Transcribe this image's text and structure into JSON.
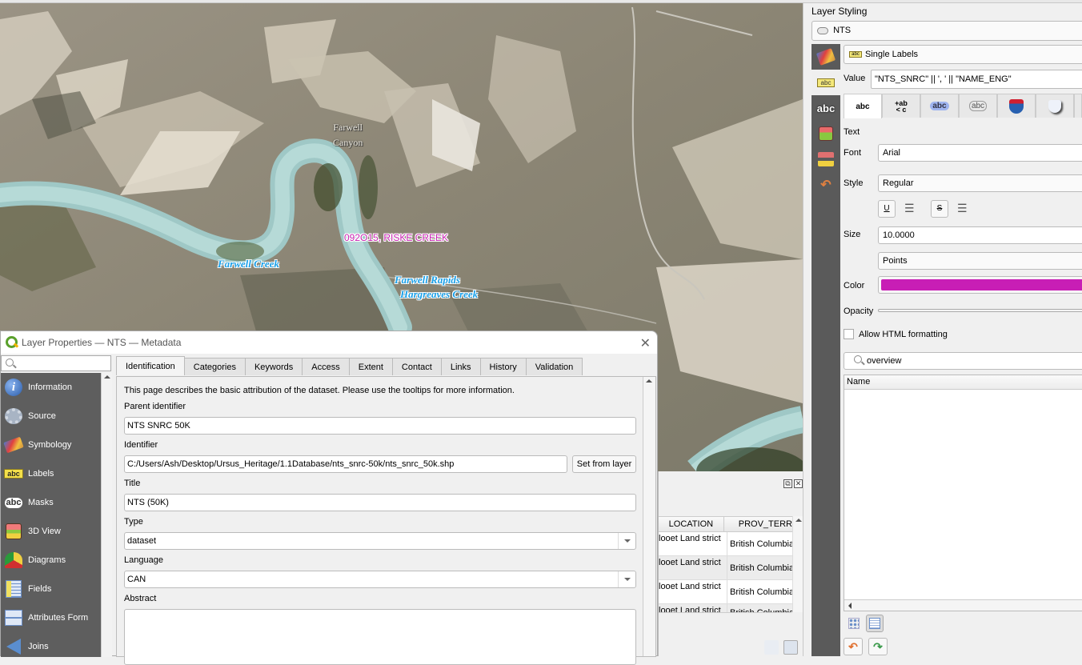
{
  "map": {
    "labels": {
      "nts_label": "092O15, RISKE CREEK",
      "farwell_creek": "Farwell Creek",
      "farwell_rapids": "Farwell Rapids",
      "hargreaves_creek": "Hargreaves Creek",
      "farwell_canyon_line1": "Farwell",
      "farwell_canyon_line2": "Canyon"
    }
  },
  "attribute_table": {
    "columns": [
      "LOCATION",
      "PROV_TERR"
    ],
    "rows": [
      {
        "location": "looet Land strict",
        "prov_terr": "British Columbia"
      },
      {
        "location": "looet Land strict",
        "prov_terr": "British Columbia"
      },
      {
        "location": "looet Land strict",
        "prov_terr": "British Columbia"
      },
      {
        "location": "looet Land strict",
        "prov_terr": "British Columbia"
      }
    ],
    "dock_float": "⧉",
    "dock_close": "✕"
  },
  "styling": {
    "title": "Layer Styling",
    "layer": "NTS",
    "renderer": "Single Labels",
    "value_label": "Value",
    "value": "\"NTS_SNRC\" || ', ' || \"NAME_ENG\"",
    "format_tabs": [
      "abc",
      "+ab<c",
      "abc",
      "abc",
      "shield",
      "shield2"
    ],
    "section_text": "Text",
    "font_label": "Font",
    "font_value": "Arial",
    "style_label": "Style",
    "style_value": "Regular",
    "underline": "U",
    "strike": "S",
    "size_label": "Size",
    "size_value": "10.0000",
    "unit_value": "Points",
    "color_label": "Color",
    "color_value": "#c81eb5",
    "opacity_label": "Opacity",
    "html_label": "Allow HTML formatting",
    "html_checked": false,
    "search_value": "overview",
    "tree_header": "Name"
  },
  "dialog": {
    "title": "Layer Properties — NTS — Metadata",
    "close": "✕",
    "search_placeholder": "",
    "nav": [
      {
        "label": "Information",
        "icon": "info-icon"
      },
      {
        "label": "Source",
        "icon": "source-icon"
      },
      {
        "label": "Symbology",
        "icon": "symbology-icon"
      },
      {
        "label": "Labels",
        "icon": "labels-icon"
      },
      {
        "label": "Masks",
        "icon": "masks-icon"
      },
      {
        "label": "3D View",
        "icon": "3d-view-icon"
      },
      {
        "label": "Diagrams",
        "icon": "diagrams-icon"
      },
      {
        "label": "Fields",
        "icon": "fields-icon"
      },
      {
        "label": "Attributes Form",
        "icon": "attributes-form-icon"
      },
      {
        "label": "Joins",
        "icon": "joins-icon"
      }
    ],
    "tabs": [
      "Identification",
      "Categories",
      "Keywords",
      "Access",
      "Extent",
      "Contact",
      "Links",
      "History",
      "Validation"
    ],
    "active_tab": "Identification",
    "intro": "This page describes the basic attribution of the dataset. Please use the tooltips for more information.",
    "parent_identifier_label": "Parent identifier",
    "parent_identifier": "NTS SNRC 50K",
    "identifier_label": "Identifier",
    "identifier": "C:/Users/Ash/Desktop/Ursus_Heritage/1.1Database/nts_snrc-50k/nts_snrc_50k.shp",
    "set_from_layer": "Set from layer",
    "title_label": "Title",
    "title_value": "NTS (50K)",
    "type_label": "Type",
    "type_value": "dataset",
    "language_label": "Language",
    "language_value": "CAN",
    "abstract_label": "Abstract",
    "abstract_value": ""
  }
}
